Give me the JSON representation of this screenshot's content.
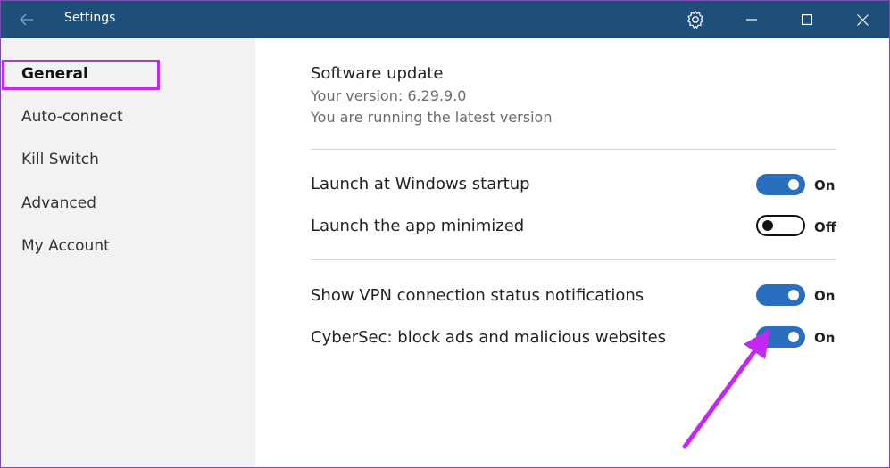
{
  "window": {
    "title": "Settings",
    "colors": {
      "titlebar": "#1e4f79",
      "sidebar": "#f2f2f2",
      "toggle_on": "#2a6fbf",
      "highlight": "#c327f2"
    }
  },
  "titlebar": {
    "back_icon": "back-arrow-icon",
    "gear_icon": "gear-icon",
    "minimize_icon": "minimize-icon",
    "maximize_icon": "maximize-icon",
    "close_icon": "close-icon"
  },
  "sidebar": {
    "items": [
      {
        "label": "General",
        "active": true
      },
      {
        "label": "Auto-connect",
        "active": false
      },
      {
        "label": "Kill Switch",
        "active": false
      },
      {
        "label": "Advanced",
        "active": false
      },
      {
        "label": "My Account",
        "active": false
      }
    ]
  },
  "main": {
    "software_update": {
      "title": "Software update",
      "version": "Your version: 6.29.9.0",
      "status": "You are running the latest version"
    },
    "settings": [
      {
        "label": "Launch at Windows startup",
        "state": "On",
        "enabled": true
      },
      {
        "label": "Launch the app minimized",
        "state": "Off",
        "enabled": false
      },
      {
        "label": "Show VPN connection status notifications",
        "state": "On",
        "enabled": true
      },
      {
        "label": "CyberSec: block ads and malicious websites",
        "state": "On",
        "enabled": true
      }
    ]
  }
}
